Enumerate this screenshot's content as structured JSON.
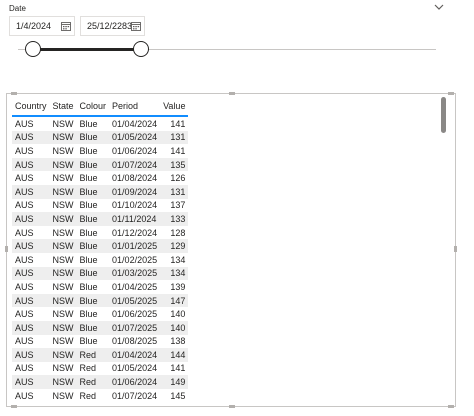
{
  "slicer": {
    "title": "Date",
    "start_date": "1/4/2024",
    "end_date": "25/12/2283",
    "range_fraction": [
      0.0,
      0.25
    ],
    "colors": {
      "track": "#c8c6c4",
      "handle": "#252423"
    }
  },
  "table": {
    "headers": [
      "Country",
      "State",
      "Colour",
      "Period",
      "Value"
    ],
    "header_underline_color": "#118dff",
    "alt_row_color": "#eeeeee",
    "rows": [
      [
        "AUS",
        "NSW",
        "Blue",
        "01/04/2024",
        "141"
      ],
      [
        "AUS",
        "NSW",
        "Blue",
        "01/05/2024",
        "131"
      ],
      [
        "AUS",
        "NSW",
        "Blue",
        "01/06/2024",
        "141"
      ],
      [
        "AUS",
        "NSW",
        "Blue",
        "01/07/2024",
        "135"
      ],
      [
        "AUS",
        "NSW",
        "Blue",
        "01/08/2024",
        "126"
      ],
      [
        "AUS",
        "NSW",
        "Blue",
        "01/09/2024",
        "131"
      ],
      [
        "AUS",
        "NSW",
        "Blue",
        "01/10/2024",
        "137"
      ],
      [
        "AUS",
        "NSW",
        "Blue",
        "01/11/2024",
        "133"
      ],
      [
        "AUS",
        "NSW",
        "Blue",
        "01/12/2024",
        "128"
      ],
      [
        "AUS",
        "NSW",
        "Blue",
        "01/01/2025",
        "129"
      ],
      [
        "AUS",
        "NSW",
        "Blue",
        "01/02/2025",
        "134"
      ],
      [
        "AUS",
        "NSW",
        "Blue",
        "01/03/2025",
        "134"
      ],
      [
        "AUS",
        "NSW",
        "Blue",
        "01/04/2025",
        "139"
      ],
      [
        "AUS",
        "NSW",
        "Blue",
        "01/05/2025",
        "147"
      ],
      [
        "AUS",
        "NSW",
        "Blue",
        "01/06/2025",
        "140"
      ],
      [
        "AUS",
        "NSW",
        "Blue",
        "01/07/2025",
        "140"
      ],
      [
        "AUS",
        "NSW",
        "Blue",
        "01/08/2025",
        "138"
      ],
      [
        "AUS",
        "NSW",
        "Red",
        "01/04/2024",
        "144"
      ],
      [
        "AUS",
        "NSW",
        "Red",
        "01/05/2024",
        "141"
      ],
      [
        "AUS",
        "NSW",
        "Red",
        "01/06/2024",
        "149"
      ],
      [
        "AUS",
        "NSW",
        "Red",
        "01/07/2024",
        "145"
      ]
    ]
  },
  "icons": {
    "collapse": "chevron-down-icon",
    "calendar": "calendar-icon"
  }
}
